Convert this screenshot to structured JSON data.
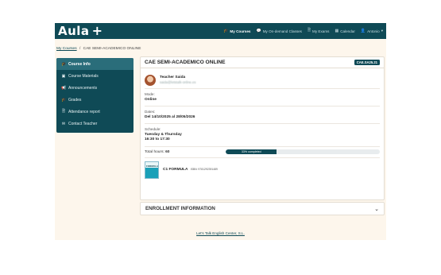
{
  "navbar": {
    "logo": "Aula",
    "logo_plus": "+",
    "links": [
      {
        "label": "My Courses",
        "icon": "graduation-cap-icon",
        "glyph": "🎓",
        "active": true
      },
      {
        "label": "My On-demand Classes",
        "icon": "chat-icon",
        "glyph": "💬",
        "active": false
      },
      {
        "label": "My Exams",
        "icon": "document-icon",
        "glyph": "🗎",
        "active": false
      },
      {
        "label": "Calendar",
        "icon": "calendar-icon",
        "glyph": "▦",
        "active": false
      },
      {
        "label": "Antonio",
        "icon": "user-icon",
        "glyph": "👤",
        "active": false,
        "caret": "▾"
      }
    ]
  },
  "breadcrumb": {
    "link": "My Courses",
    "separator": "/",
    "current": "CAE SEMI-ACADEMICO ONLINE"
  },
  "sidebar": {
    "items": [
      {
        "label": "Course Info",
        "icon": "graduation-cap-icon",
        "glyph": "🎓",
        "active": true
      },
      {
        "label": "Course Materials",
        "icon": "book-icon",
        "glyph": "▣",
        "active": false
      },
      {
        "label": "Announcements",
        "icon": "megaphone-icon",
        "glyph": "📢",
        "active": false
      },
      {
        "label": "Grades",
        "icon": "graduation-cap-icon",
        "glyph": "🎓",
        "active": false
      },
      {
        "label": "Attendance report",
        "icon": "document-icon",
        "glyph": "🗎",
        "active": false
      },
      {
        "label": "Contact Teacher",
        "icon": "envelope-icon",
        "glyph": "✉",
        "active": false
      }
    ]
  },
  "course": {
    "title": "CAE SEMI-ACADEMICO ONLINE",
    "code": "CAE.SA25.21",
    "teacher": {
      "name": "Teacher Saida",
      "email": "saida@letstalk-online.es"
    },
    "mode_label": "Mode:",
    "mode_value": "Online",
    "dates_label": "Dates:",
    "dates_value": "Del 14/10/2025 al 28/05/2026",
    "schedule_label": "Schedule:",
    "schedule_days": "Tuesday & Thursday",
    "schedule_time": "16:30 to 17:30",
    "hours_label": "Total hours:",
    "hours_value": "60",
    "progress": {
      "percent": 33,
      "text": "33% completed"
    },
    "book": {
      "title": "C1 FORMULA",
      "isbn": "ISBN: 9781292391489",
      "cover_text": "FORMULA"
    }
  },
  "enrollment": {
    "title": "ENROLLMENT INFORMATION",
    "icon": "chevron-down-icon"
  },
  "footer": {
    "link": "Let's Talk English Center, S.L."
  },
  "colors": {
    "primary": "#0f4a56",
    "background": "#fdf6ec"
  }
}
